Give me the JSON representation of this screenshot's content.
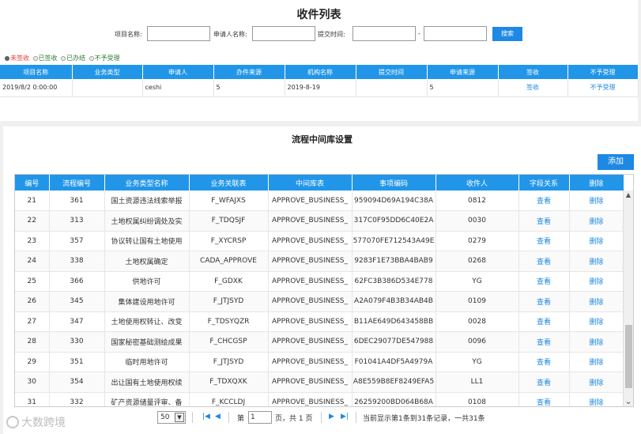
{
  "top": {
    "title": "收件列表",
    "search": {
      "project_label": "项目名称:",
      "applicant_label": "申请人名称:",
      "time_label": "提交时间:",
      "dash": "-",
      "button": "搜索",
      "project_value": "",
      "applicant_value": "",
      "time_from": "",
      "time_to": ""
    },
    "filters": [
      {
        "label": "未签收",
        "checked": true,
        "color": "#e53935"
      },
      {
        "label": "已签收",
        "checked": false,
        "color": "#2e7d32"
      },
      {
        "label": "已办结",
        "checked": false,
        "color": "#2e7d32"
      },
      {
        "label": "不予受理",
        "checked": false,
        "color": "#2e7d32"
      }
    ],
    "table": {
      "headers": [
        "项目名称",
        "业务类型",
        "申请人",
        "办件来源",
        "机构名称",
        "提交时间",
        "申请来源",
        "签收",
        "不予受理"
      ],
      "row": {
        "project": "2019/8/2 0:00:00",
        "biz_type": "",
        "applicant": "ceshi",
        "source": "5",
        "org": "2019-8-19",
        "time": "",
        "apply_source": "5",
        "sign": "签收",
        "reject": "不予受理"
      }
    }
  },
  "lower": {
    "title": "流程中间库设置",
    "add_button": "添加",
    "headers": [
      "编号",
      "流程编号",
      "业务类型名称",
      "业务关联表",
      "中间库表",
      "事项编码",
      "收件人",
      "字段关系",
      "删除"
    ],
    "rows": [
      [
        "21",
        "361",
        "国土资源违法线索举报",
        "F_WFAJXS",
        "APPROVE_BUSINESS_",
        "959094D69A194C38A",
        "0812"
      ],
      [
        "22",
        "313",
        "土地权属纠纷调处及实",
        "F_TDQSJF",
        "APPROVE_BUSINESS_",
        "317C0F95DD6C40E2A",
        "0030"
      ],
      [
        "23",
        "357",
        "协议转让国有土地使用",
        "F_XYCRSP",
        "APPROVE_BUSINESS_",
        "577070FE712543A49E",
        "0279"
      ],
      [
        "24",
        "338",
        "土地权属确定",
        "CADA_APPROVE",
        "APPROVE_BUSINESS_",
        "9283F1E73BBA4BAB9",
        "0268"
      ],
      [
        "25",
        "366",
        "供地许可",
        "F_GDXK",
        "APPROVE_BUSINESS_",
        "62FC3B386D534E778",
        "YG"
      ],
      [
        "26",
        "345",
        "集体建设用地许可",
        "F_JTJSYD",
        "APPROVE_BUSINESS_",
        "A2A079F4B3B34AB4B",
        "0109"
      ],
      [
        "27",
        "347",
        "土地使用权转让、改变",
        "F_TDSYQZR",
        "APPROVE_BUSINESS_",
        "B11AE649D643458BB",
        "0028"
      ],
      [
        "28",
        "330",
        "国家秘密基础测绘成果",
        "F_CHCGSP",
        "APPROVE_BUSINESS_",
        "6DEC29077DE547988",
        "0096"
      ],
      [
        "29",
        "351",
        "临时用地许可",
        "F_JTJSYD",
        "APPROVE_BUSINESS_",
        "F01041A4DF5A4979A",
        "YG"
      ],
      [
        "30",
        "354",
        "出让国有土地使用权续",
        "F_TDXQXK",
        "APPROVE_BUSINESS_",
        "A8E559B8EF8249EFA5",
        "LL1"
      ],
      [
        "31",
        "332",
        "矿产资源储量评审、备",
        "F_KCCLDJ",
        "APPROVE_BUSINESS_",
        "26259200BD064B68A",
        "0108"
      ]
    ],
    "view_label": "查看",
    "delete_label": "删除",
    "pager": {
      "page_size": "50",
      "page_prefix": "第",
      "page_value": "1",
      "page_suffix": "页，共 1 页",
      "summary": "当前显示第1条到31条记录，一共31条"
    }
  },
  "watermark": "大数跨境"
}
